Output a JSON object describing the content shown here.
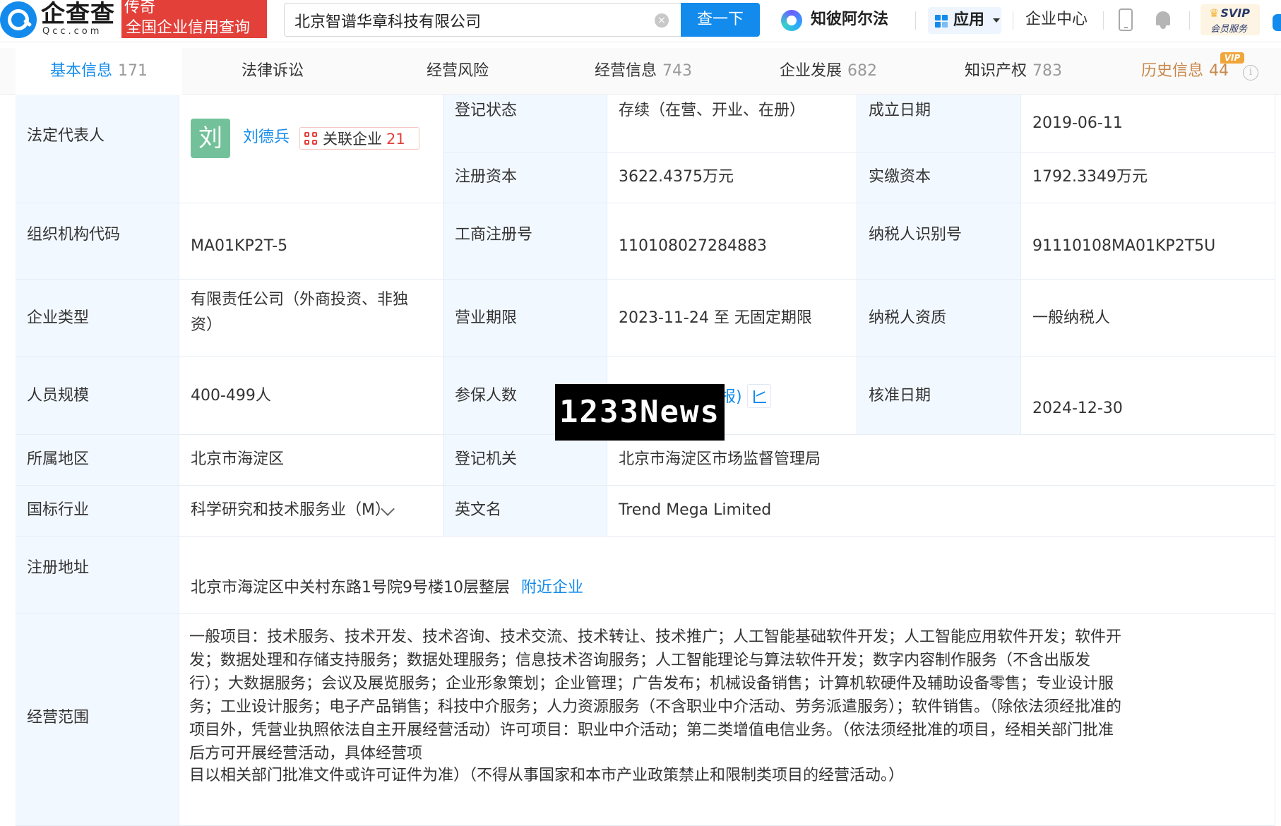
{
  "header": {
    "logo_text": "企查查",
    "logo_sub": "Qcc.com",
    "promo_line1": "传奇",
    "promo_line2": "全国企业信用查询",
    "search_value": "北京智谱华章科技有限公司",
    "search_button": "查一下",
    "nav_zhibo": "知彼阿尔法",
    "nav_app": "应用",
    "nav_center": "企业中心",
    "svip_top": "SVIP",
    "svip_bottom": "会员服务"
  },
  "tabs": [
    {
      "label": "基本信息",
      "count": "171"
    },
    {
      "label": "法律诉讼",
      "count": ""
    },
    {
      "label": "经营风险",
      "count": ""
    },
    {
      "label": "经营信息",
      "count": "743"
    },
    {
      "label": "企业发展",
      "count": "682"
    },
    {
      "label": "知识产权",
      "count": "783"
    },
    {
      "label": "历史信息",
      "count": "44"
    }
  ],
  "vip_badge": "VIP",
  "info": {
    "legal_rep_label": "法定代表人",
    "legal_rep_avatar": "刘",
    "legal_rep_name": "刘德兵",
    "related_label": "关联企业",
    "related_count": "21",
    "reg_status_label": "登记状态",
    "reg_status": "存续（在营、开业、在册）",
    "founded_label": "成立日期",
    "founded": "2019-06-11",
    "reg_capital_label": "注册资本",
    "reg_capital": "3622.4375万元",
    "paid_capital_label": "实缴资本",
    "paid_capital": "1792.3349万元",
    "org_code_label": "组织机构代码",
    "org_code": "MA01KP2T-5",
    "biz_reg_no_label": "工商注册号",
    "biz_reg_no": "110108027284883",
    "taxpayer_id_label": "纳税人识别号",
    "taxpayer_id": "91110108MA01KP2T5U",
    "company_type_label": "企业类型",
    "company_type_line1": "有限责任公司（外商投资、非独",
    "company_type_line2": "资）",
    "term_label": "营业期限",
    "term": "2023-11-24 至 无固定期限",
    "taxpayer_qual_label": "纳税人资质",
    "taxpayer_qual": "一般纳税人",
    "staff_label": "人员规模",
    "staff": "400-499人",
    "insured_label": "参保人数",
    "insured_partial": "报)",
    "approved_label": "核准日期",
    "approved": "2024-12-30",
    "region_label": "所属地区",
    "region": "北京市海淀区",
    "reg_authority_label": "登记机关",
    "reg_authority": "北京市海淀区市场监督管理局",
    "industry_label": "国标行业",
    "industry": "科学研究和技术服务业（M）",
    "english_name_label": "英文名",
    "english_name": "Trend Mega Limited",
    "address_label": "注册地址",
    "address": "北京市海淀区中关村东路1号院9号楼10层整层",
    "nearby_link": "附近企业",
    "scope_label": "经营范围",
    "scope_main": "一般项目：技术服务、技术开发、技术咨询、技术交流、技术转让、技术推广；人工智能基础软件开发；人工智能应用软件开发；软件开发；数据处理和存储支持服务；数据处理服务；信息技术咨询服务；人工智能理论与算法软件开发；数字内容制作服务（不含出版发行）；大数据服务；会议及展览服务；企业形象策划；企业管理；广告发布；机械设备销售；计算机软硬件及辅助设备零售；专业设计服务；工业设计服务；电子产品销售；科技中介服务；人力资源服务（不含职业中介活动、劳务派遣服务）；软件销售。（除依法须经批准的项目外，凭营业执照依法自主开展经营活动）许可项目：职业中介活动；第二类增值电信业务。（依法须经批准的项目，经相关部门批准后方可开展经营活动，具体经营项",
    "scope_last": "目以相关部门批准文件或许可证件为准）（不得从事国家和本市产业政策禁止和限制类项目的经营活动。）"
  },
  "watermark": "1233News",
  "colors": {
    "brand_blue": "#128bed",
    "label_bg": "#f2f8ff",
    "promo_red": "#e3403a",
    "history_gold": "#c8884b"
  }
}
